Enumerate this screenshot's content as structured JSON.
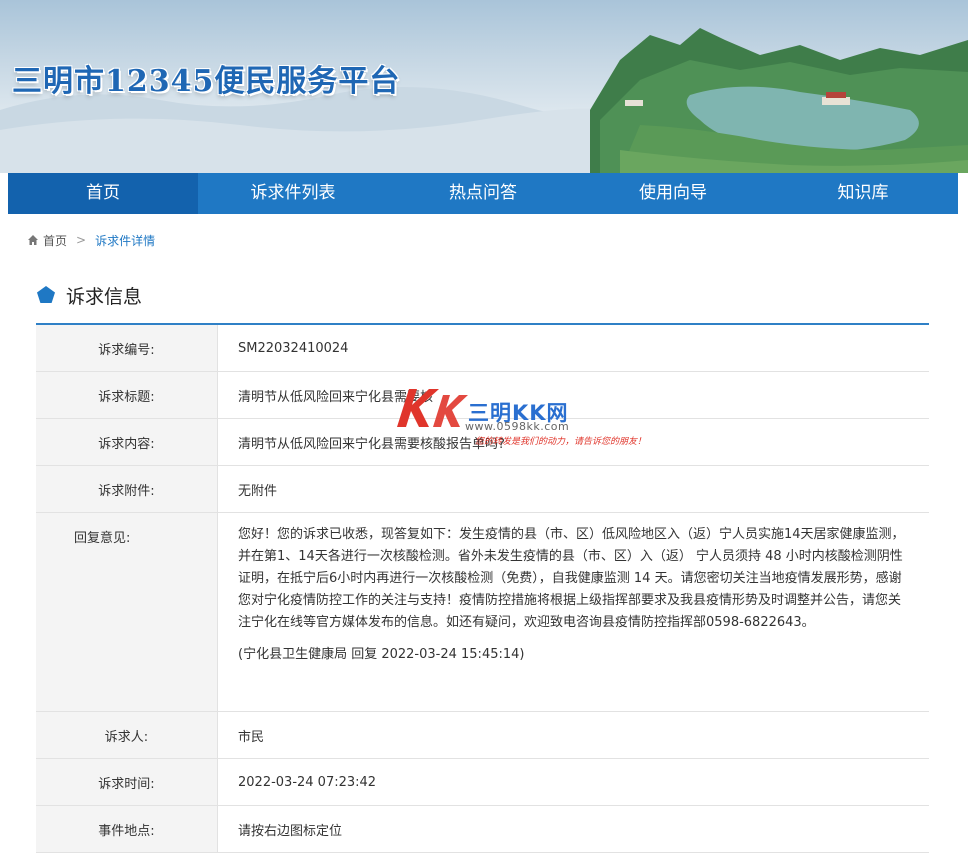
{
  "header": {
    "site_title": "三明市12345便民服务平台"
  },
  "nav": {
    "items": [
      {
        "label": "首页",
        "active": true
      },
      {
        "label": "诉求件列表",
        "active": false
      },
      {
        "label": "热点问答",
        "active": false
      },
      {
        "label": "使用向导",
        "active": false
      },
      {
        "label": "知识库",
        "active": false
      }
    ]
  },
  "breadcrumb": {
    "home": "首页",
    "separator": ">",
    "current": "诉求件详情",
    "home_icon": "home-icon"
  },
  "section": {
    "title": "诉求信息",
    "icon": "pentagon-icon"
  },
  "info": {
    "number_label": "诉求编号:",
    "number": "SM22032410024",
    "title_label": "诉求标题:",
    "title": "清明节从低风险回来宁化县需要核",
    "content_label": "诉求内容:",
    "content": "清明节从低风险回来宁化县需要核酸报告单吗?",
    "attachment_label": "诉求附件:",
    "attachment": "无附件",
    "reply_label": "回复意见:",
    "reply_text": "您好！您的诉求已收悉，现答复如下：发生疫情的县（市、区）低风险地区入（返）宁人员实施14天居家健康监测，并在第1、14天各进行一次核酸检测。省外未发生疫情的县（市、区）入（返） 宁人员须持 48 小时内核酸检测阴性证明，在抵宁后6小时内再进行一次核酸检测（免费），自我健康监测 14 天。请您密切关注当地疫情发展形势，感谢您对宁化疫情防控工作的关注与支持！疫情防控措施将根据上级指挥部要求及我县疫情形势及时调整并公告，请您关注宁化在线等官方媒体发布的信息。如还有疑问，欢迎致电咨询县疫情防控指挥部0598-6822643。",
    "reply_sign": "(宁化县卫生健康局 回复 2022-03-24 15:45:14)",
    "person_label": "诉求人:",
    "person": "市民",
    "time_label": "诉求时间:",
    "time": "2022-03-24 07:23:42",
    "location_label": "事件地点:",
    "location": "请按右边图标定位"
  },
  "watermark": {
    "name": "三明KK网",
    "url": "www.0598kk.com",
    "slogan": "您的转发是我们的动力，请告诉您的朋友！"
  },
  "colors": {
    "nav_bg": "#1f78c4",
    "nav_active": "#1362ad",
    "accent": "#2f80c6",
    "title_blue": "#1f67b4"
  }
}
